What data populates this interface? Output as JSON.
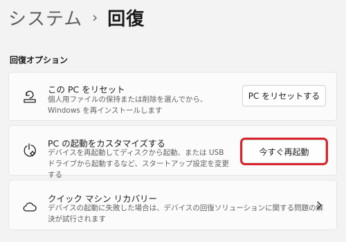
{
  "breadcrumb": {
    "parent": "システム",
    "separator": "›",
    "current": "回復"
  },
  "section_title": "回復オプション",
  "cards": [
    {
      "title": "この PC をリセット",
      "description": "個人用ファイルの保持または削除を選んでから、Windows を再インストールします",
      "button_label": "PC をリセットする",
      "icon": "reset-pc-icon"
    },
    {
      "title": "PC の起動をカスタマイズする",
      "description": "デバイスを再起動してディスクから起動、または USB ドライブから起動するなど、スタートアップ設定を変更する",
      "button_label": "今すぐ再起動",
      "icon": "advanced-startup-icon",
      "highlight_color": "#d9222a"
    },
    {
      "title": "クイック マシン リカバリー",
      "description": "デバイスの起動に失敗した場合は、デバイスの回復ソリューションに関する問題の解決が試行されます",
      "icon": "cloud-icon",
      "chevron_icon": "chevron-right-icon"
    }
  ],
  "colors": {
    "background": "#f3f3f3",
    "card": "#fbfbfb",
    "highlight": "#d9222a"
  }
}
